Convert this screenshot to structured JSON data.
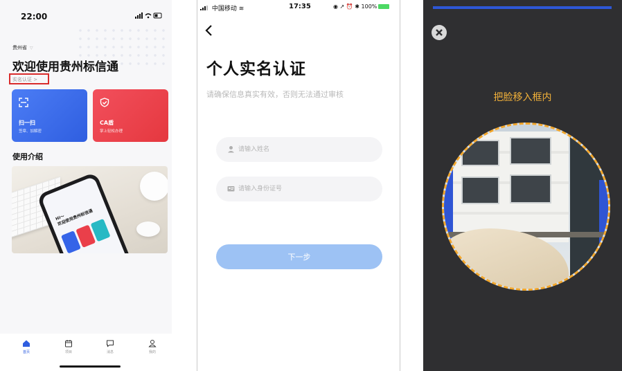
{
  "screen1": {
    "status": {
      "time": "22:00"
    },
    "province": "贵州省",
    "welcome": "欢迎使用贵州标信通",
    "real_name_link": "实名认证 >",
    "cards": [
      {
        "title": "扫一扫",
        "subtitle": "签章、加解密",
        "color": "#3564e8",
        "icon": "scan-icon"
      },
      {
        "title": "CA盾",
        "subtitle": "掌上轻松办理",
        "color": "#ea3f4a",
        "icon": "shield-icon"
      }
    ],
    "intro_title": "使用介绍",
    "banner": {
      "greeting": "Hi～\n欢迎使用贵州标信通"
    },
    "tabbar": [
      {
        "label": "首页",
        "icon": "home-icon",
        "active": true
      },
      {
        "label": "项目",
        "icon": "calendar-icon",
        "active": false
      },
      {
        "label": "消息",
        "icon": "message-icon",
        "active": false
      },
      {
        "label": "我的",
        "icon": "user-icon",
        "active": false
      }
    ]
  },
  "screen2": {
    "status": {
      "carrier": "中国移动",
      "time": "17:35",
      "battery": "100%"
    },
    "back_icon": "back-arrow-icon",
    "title": "个人实名认证",
    "subtitle": "请确保信息真实有效，否则无法通过审核",
    "name_field": {
      "placeholder": "请输入姓名",
      "value": ""
    },
    "id_field": {
      "placeholder": "请输入身份证号",
      "value": ""
    },
    "next_button": "下一步",
    "accent": "#9dc2f4"
  },
  "screen3": {
    "close_icon": "close-icon",
    "hint": "把脸移入框内",
    "frame_color": "#f3a72c"
  }
}
